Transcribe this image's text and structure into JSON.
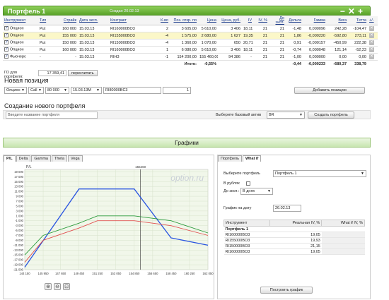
{
  "portfolio": {
    "title": "Портфель 1",
    "created": "Создан 20.02.13",
    "controls": [
      "−",
      "✕",
      "+"
    ]
  },
  "positions": {
    "headers": [
      "Инструмент",
      "Тип",
      "Страйк",
      "Дата эксп.",
      "Контракт",
      "К-во",
      "Поз. откр. по",
      "Цена",
      "Цена, руб.",
      "IV",
      "IV, %",
      "До эксп.",
      "Дельта",
      "Гамма",
      "Вега",
      "Тетта",
      "+/-"
    ],
    "rows": [
      {
        "instrument": "Опцион",
        "type": "Put",
        "strike": "160 000",
        "date": "15.03.13",
        "contract": "RI160000BO3",
        "qty": "2",
        "open_price": "3 605,00",
        "price": "5 610,00",
        "price_rub": "3 406",
        "iv": "18,11",
        "iv_pct": "21",
        "to_exp": "21",
        "delta": "-1,48",
        "gamma": "0,000096",
        "vega": "242,28",
        "theta": "-104,47",
        "hl": false
      },
      {
        "instrument": "Опцион",
        "type": "Put",
        "strike": "155 000",
        "date": "15.03.13",
        "contract": "RI155000BO3",
        "qty": "-4",
        "open_price": "1 575,00",
        "price": "2 680,00",
        "price_rub": "1 627",
        "iv": "19,35",
        "iv_pct": "21",
        "to_exp": "21",
        "delta": "1,86",
        "gamma": "-0,000220",
        "vega": "-592,80",
        "theta": "273,11",
        "hl": true
      },
      {
        "instrument": "Опцион",
        "type": "Put",
        "strike": "150 000",
        "date": "15.03.13",
        "contract": "RI150000BO3",
        "qty": "-4",
        "open_price": "1 360,00",
        "price": "1 070,00",
        "price_rub": "650",
        "iv": "20,71",
        "iv_pct": "21",
        "to_exp": "21",
        "delta": "0,91",
        "gamma": "-0,000157",
        "vega": "-450,99",
        "theta": "222,38",
        "hl": false
      },
      {
        "instrument": "Опцион",
        "type": "Put",
        "strike": "160 000",
        "date": "15.03.13",
        "contract": "RI160000BO3",
        "qty": "1",
        "open_price": "6 080,00",
        "price": "5 610,00",
        "price_rub": "3 406",
        "iv": "18,11",
        "iv_pct": "21",
        "to_exp": "21",
        "delta": "-0,74",
        "gamma": "0,000048",
        "vega": "121,14",
        "theta": "-52,23",
        "hl": false
      },
      {
        "instrument": "Фьючерс",
        "type": "-",
        "strike": "-",
        "date": "15.03.13",
        "contract": "RIH3",
        "qty": "-1",
        "open_price": "154 200,00",
        "price": "155 460,00",
        "price_rub": "94 386",
        "iv": "-",
        "iv_pct": "21",
        "to_exp": "21",
        "delta": "-1,00",
        "gamma": "0,000000",
        "vega": "0,00",
        "theta": "0,00",
        "hl": false
      }
    ],
    "total_label": "Итого:",
    "total_pct": "-0,55%",
    "total_delta": "-0,44",
    "total_gamma": "-0,000233",
    "total_vega": "-680,37",
    "total_theta": "338,79"
  },
  "go": {
    "label": "ГО для портфеля:",
    "value": "17 359,41",
    "recalc": "пересчитать"
  },
  "new_position": {
    "title": "Новая позиция",
    "instrument": "Опцион",
    "type": "Call",
    "strike": "80 000",
    "date": "15.03.13M",
    "contract": "RI80000BC3",
    "qty": "1",
    "add_button": "Добавить позицию"
  },
  "create_portfolio": {
    "title": "Создание нового портфеля",
    "name_placeholder": "Введите название портфеля",
    "base_label": "Выберите базовый актив",
    "base_value": "BR",
    "create_button": "Создать портфель"
  },
  "charts": {
    "title": "Графики",
    "tabs": [
      "P/L",
      "Delta",
      "Gamma",
      "Theta",
      "Vega"
    ],
    "right_tabs": [
      "Портфель",
      "What if"
    ]
  },
  "chart_data": {
    "type": "line",
    "ylabel": "P/L",
    "marker_label": "155460",
    "marker_x": 155460,
    "watermark": "option.ru",
    "x": [
      144150,
      145950,
      147650,
      149450,
      151250,
      153050,
      154850,
      156650,
      158450,
      160250,
      162050
    ],
    "x_ticks": [
      "144 150",
      "145 950",
      "147 650",
      "149 450",
      "151 250",
      "153 050",
      "154 850",
      "156 650",
      "158 450",
      "160 250",
      "162 050"
    ],
    "ylim": [
      -21000,
      20000
    ],
    "y_ticks": [
      -21000,
      -19000,
      -17000,
      -15000,
      -13000,
      -11000,
      -9000,
      -7000,
      -5000,
      -3000,
      -1000,
      1000,
      3000,
      5000,
      7000,
      9000,
      11000,
      13000,
      15000,
      17000,
      19000
    ],
    "y_tick_labels": [
      "-21 000",
      "-19 000",
      "-17 000",
      "-15 000",
      "-13 000",
      "-11 000",
      "-9 000",
      "-7 000",
      "-5 000",
      "-3 000",
      "-1 000",
      "1 000",
      "3 000",
      "5 000",
      "7 000",
      "9 000",
      "11 000",
      "13 000",
      "15 000",
      "17 000",
      "19 000"
    ],
    "series": [
      {
        "color": "#2a55e0",
        "points": [
          [
            144150,
            -20000
          ],
          [
            149450,
            12000
          ],
          [
            151250,
            12000
          ],
          [
            154850,
            12000
          ],
          [
            158450,
            -8000
          ],
          [
            162050,
            -11000
          ]
        ]
      },
      {
        "color": "#2a9a3a",
        "points": [
          [
            144150,
            -15000
          ],
          [
            145950,
            -7000
          ],
          [
            149450,
            -2000
          ],
          [
            151250,
            1000
          ],
          [
            154850,
            1000
          ],
          [
            158450,
            -1000
          ],
          [
            162050,
            -6000
          ]
        ]
      },
      {
        "color": "#e05050",
        "points": [
          [
            144150,
            -18000
          ],
          [
            145950,
            -9000
          ],
          [
            149450,
            -4000
          ],
          [
            151250,
            -1000
          ],
          [
            154850,
            -1000
          ],
          [
            158450,
            -3000
          ],
          [
            162050,
            -7000
          ]
        ]
      }
    ],
    "zoom_icons": [
      "zoom-in",
      "zoom-out",
      "zoom-reset"
    ]
  },
  "whatif": {
    "portfolio_label": "Выберите портфель",
    "portfolio_value": "Портфель 1",
    "in_rub_label": "В рублях",
    "to_exp_label": "До эксп.:",
    "to_exp_value": "В днях",
    "chart_date_label": "График на дату",
    "chart_date_value": "26.02.13",
    "table_headers": [
      "Инструмент",
      "Реальная IV, %",
      "What if IV, %"
    ],
    "group_label": "Портфель 1",
    "rows": [
      {
        "instrument": "RI160000BO3",
        "iv": "19,05"
      },
      {
        "instrument": "RI155000BO3",
        "iv": "19,93"
      },
      {
        "instrument": "RI150000BO3",
        "iv": "21,15"
      },
      {
        "instrument": "RI160000BO3",
        "iv": "19,05"
      }
    ],
    "build_button": "Построить график"
  }
}
